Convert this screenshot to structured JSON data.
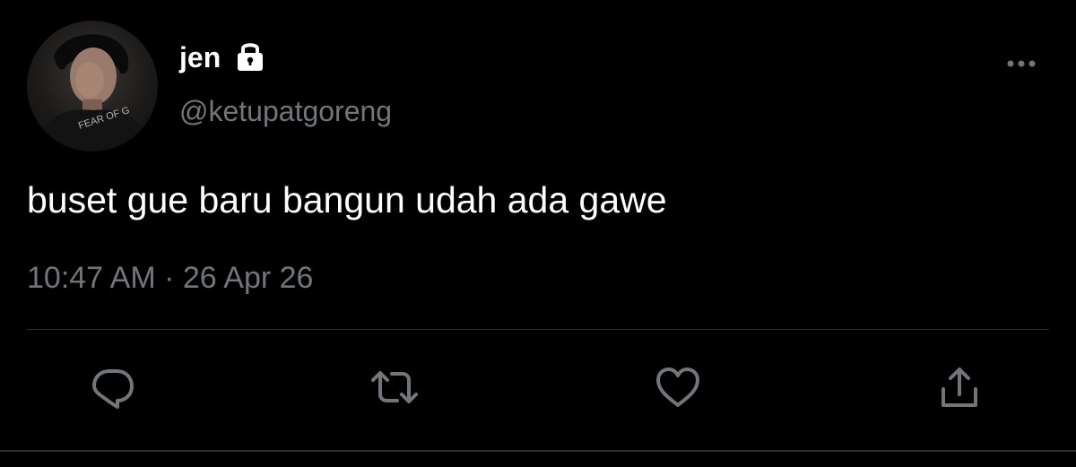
{
  "tweet": {
    "display_name": "jen",
    "handle": "@ketupatgoreng",
    "text": "buset gue baru bangun udah ada gawe",
    "time": "10:47 AM",
    "separator": "·",
    "date": "26 Apr 26",
    "avatar_shirt_text": "FEAR OF G"
  },
  "icons": {
    "lock": "lock-icon",
    "more": "more-dots-icon",
    "reply": "reply-bubble-icon",
    "retweet": "retweet-icon",
    "like": "heart-icon",
    "share": "share-upload-icon"
  },
  "colors": {
    "background": "#000000",
    "primary_text": "#ffffff",
    "secondary_text": "#71767b",
    "divider": "#2f3336"
  }
}
